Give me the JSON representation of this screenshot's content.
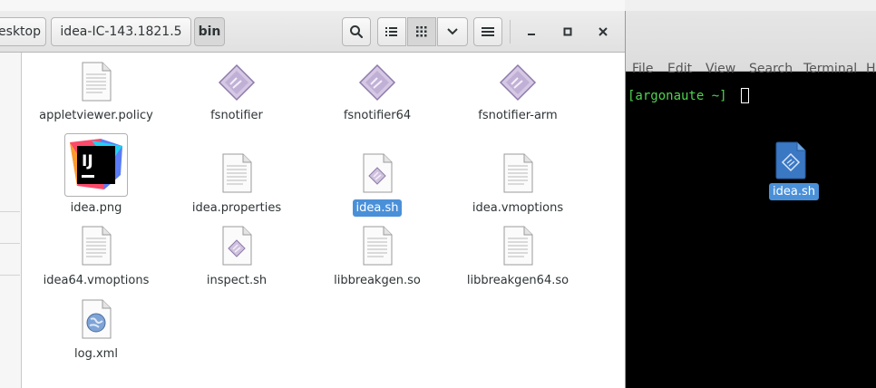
{
  "file_manager": {
    "breadcrumb": {
      "desktop": "Desktop",
      "folder": "idea-IC-143.1821.5",
      "current": "bin"
    },
    "toolbar": {
      "search_icon": "search-icon",
      "list_view_icon": "list-view-icon",
      "grid_view_icon": "grid-view-icon",
      "view_options_icon": "chevron-down-icon",
      "menu_icon": "hamburger-icon"
    },
    "window_controls": {
      "minimize": "minimize-icon",
      "maximize": "maximize-icon",
      "close": "close-icon"
    },
    "files": [
      {
        "name": "appletviewer.policy",
        "icon": "text-file-icon"
      },
      {
        "name": "fsnotifier",
        "icon": "executable-icon"
      },
      {
        "name": "fsnotifier64",
        "icon": "executable-icon"
      },
      {
        "name": "fsnotifier-arm",
        "icon": "executable-icon"
      },
      {
        "name": "idea.png",
        "icon": "intellij-image-icon"
      },
      {
        "name": "idea.properties",
        "icon": "text-file-icon"
      },
      {
        "name": "idea.sh",
        "icon": "script-file-icon",
        "selected": true
      },
      {
        "name": "idea.vmoptions",
        "icon": "text-file-icon"
      },
      {
        "name": "idea64.vmoptions",
        "icon": "text-file-icon"
      },
      {
        "name": "inspect.sh",
        "icon": "script-file-icon"
      },
      {
        "name": "libbreakgen.so",
        "icon": "text-file-icon"
      },
      {
        "name": "libbreakgen64.so",
        "icon": "text-file-icon"
      },
      {
        "name": "log.xml",
        "icon": "xml-file-icon"
      }
    ]
  },
  "terminal": {
    "menu": [
      "File",
      "Edit",
      "View",
      "Search",
      "Terminal",
      "Help"
    ],
    "prompt": "[argonaute ~] "
  },
  "desktop": {
    "icon_label": "idea.sh",
    "icon": "script-file-icon"
  },
  "colors": {
    "selection": "#4a90d9",
    "prompt_green": "#4fd44f",
    "terminal_bg": "#000000"
  }
}
